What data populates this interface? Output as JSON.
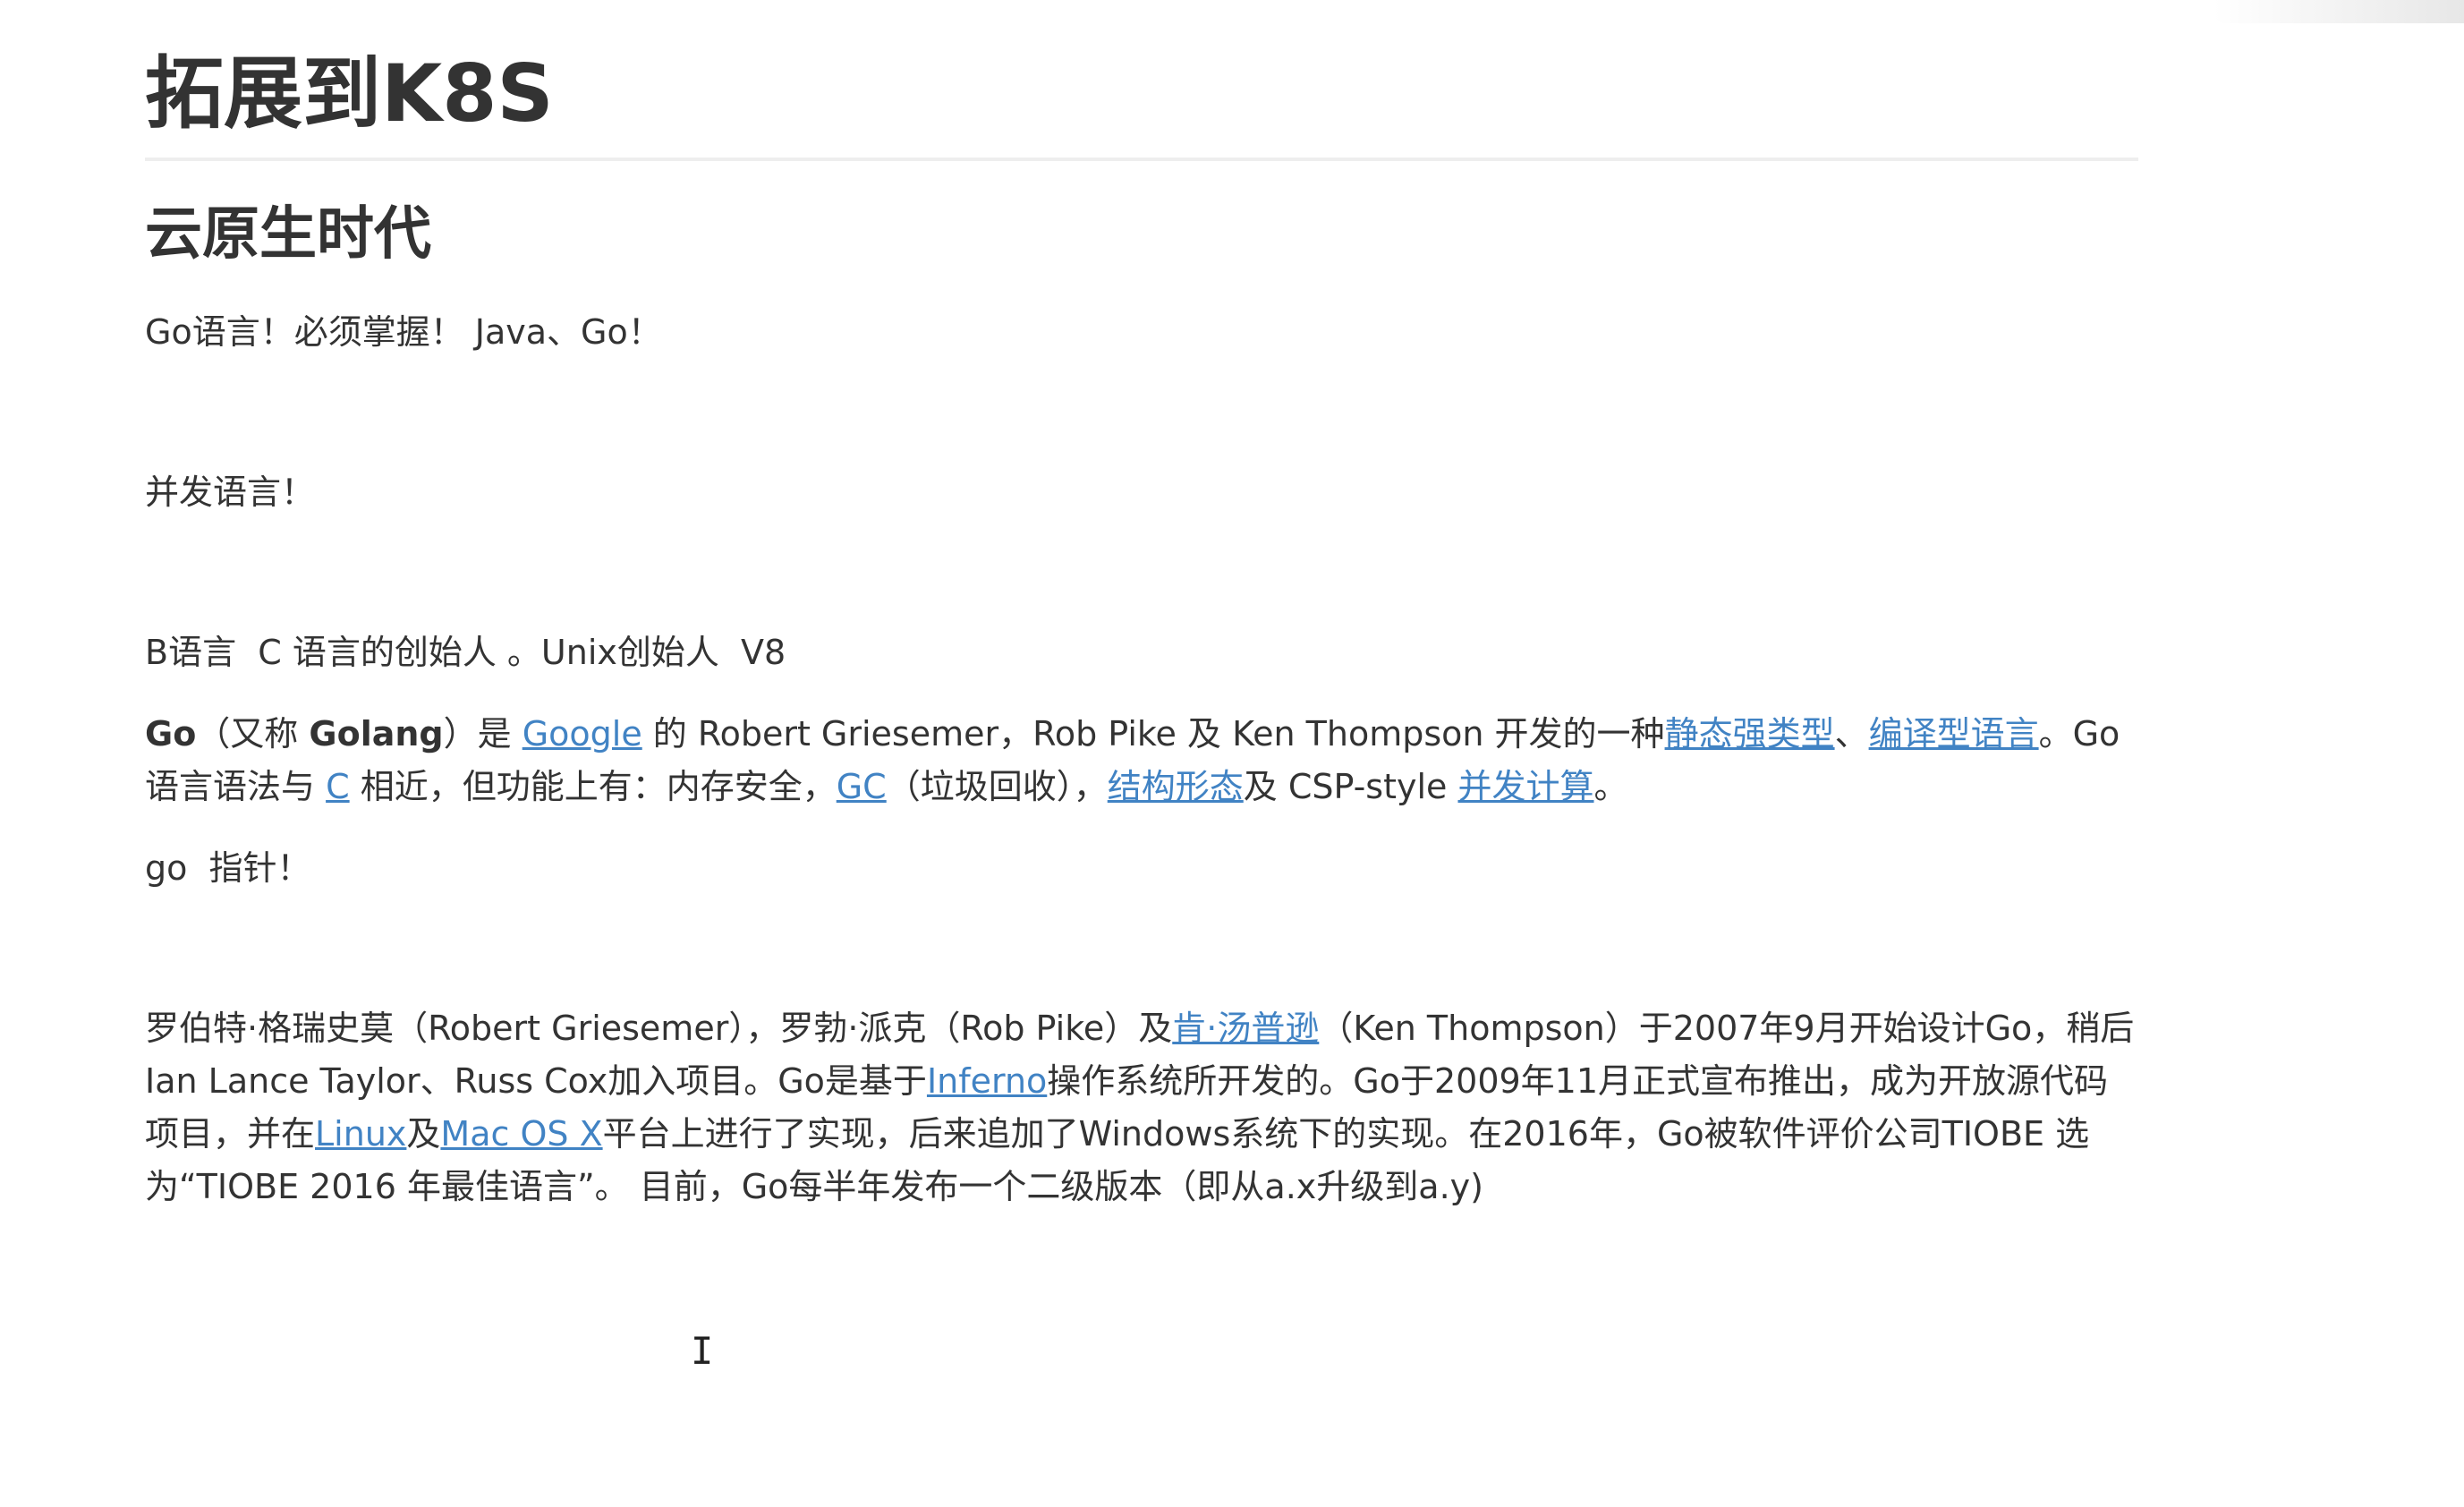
{
  "doc": {
    "title": "拓展到K8S",
    "section_title": "云原生时代",
    "p1": "Go语言！必须掌握！ Java、Go！",
    "p2": "并发语言！",
    "p3": "B语言  C 语言的创始人 。Unix创始人  V8",
    "p4": {
      "go_label": "Go",
      "t1": "（又称 ",
      "golang_label": "Golang",
      "t2": "）是 ",
      "link_google": "Google",
      "t3": " 的 Robert Griesemer，Rob Pike 及 Ken Thompson 开发的一种",
      "link_static": "静态强类型",
      "t4": "、",
      "link_compiled": "编译型语言",
      "t5": "。Go 语言语法与 ",
      "link_c": "C",
      "t6": " 相近，但功能上有：内存安全，",
      "link_gc": "GC",
      "t7": "（垃圾回收），",
      "link_struct": "结构形态",
      "t8": "及 CSP-style ",
      "link_concurrency": "并发计算",
      "t9": "。"
    },
    "p5": "go  指针！",
    "p6": {
      "t1": "罗伯特·格瑞史莫（Robert Griesemer），罗勃·派克（Rob Pike）及",
      "link_ken": "肯·汤普逊",
      "t2": "（Ken Thompson）于2007年9月开始设计Go，稍后Ian Lance Taylor、Russ Cox加入项目。Go是基于",
      "link_inferno": "Inferno",
      "t3": "操作系统所开发的。Go于2009年11月正式宣布推出，成为开放源代码项目，并在",
      "link_linux": "Linux",
      "t4": "及",
      "link_macos": "Mac OS X",
      "t5": "平台上进行了实现，后来追加了Windows系统下的实现。在2016年，Go被软件评价公司TIOBE 选为“TIOBE 2016 年最佳语言”。 目前，Go每半年发布一个二级版本（即从a.x升级到a.y)"
    },
    "cursor_glyph": "I"
  },
  "colors": {
    "text": "#333333",
    "link": "#4183c4",
    "rule": "#eeeeee"
  }
}
